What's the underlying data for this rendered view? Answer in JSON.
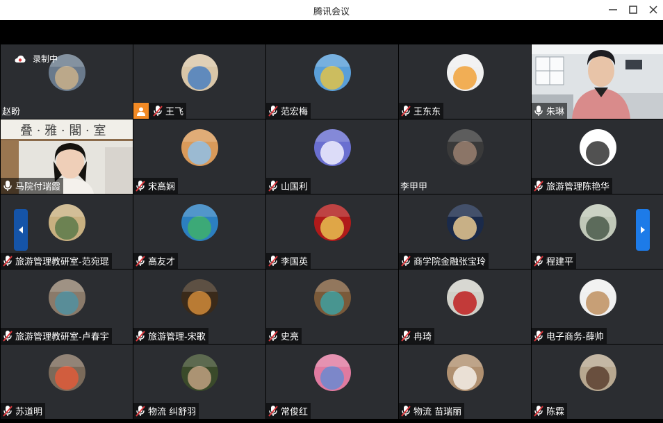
{
  "window": {
    "title": "腾讯会议"
  },
  "recording": {
    "label": "录制中"
  },
  "participants": [
    {
      "name": "赵盼",
      "mic": "none",
      "avatar": "boy-photo-icon"
    },
    {
      "name": "王飞",
      "mic": "muted",
      "host": true,
      "avatar": "castle-photo-icon"
    },
    {
      "name": "范宏梅",
      "mic": "muted",
      "avatar": "wheat-photo-icon"
    },
    {
      "name": "王东东",
      "mic": "muted",
      "avatar": "flower-icon"
    },
    {
      "name": "朱琳",
      "mic": "on",
      "video": true
    },
    {
      "name": "马院付瑞霞",
      "mic": "on",
      "video": true
    },
    {
      "name": "宋高娴",
      "mic": "muted",
      "avatar": "bird-photo-icon"
    },
    {
      "name": "山国利",
      "mic": "muted",
      "avatar": "palace-photo-icon"
    },
    {
      "name": "李甲甲",
      "mic": "none",
      "avatar": "man-photo-icon"
    },
    {
      "name": "旅游管理陈艳华",
      "mic": "muted",
      "avatar": "cartoon-avatar-icon"
    },
    {
      "name": "旅游管理教研室-范宛琨",
      "mic": "muted",
      "avatar": "palm-tree-icon"
    },
    {
      "name": "高友才",
      "mic": "muted",
      "avatar": "beach-photo-icon"
    },
    {
      "name": "李国英",
      "mic": "muted",
      "avatar": "opera-photo-icon"
    },
    {
      "name": "商学院金融张宝玲",
      "mic": "muted",
      "avatar": "pearl-earring-icon"
    },
    {
      "name": "程建平",
      "mic": "muted",
      "avatar": "landscape-photo-icon"
    },
    {
      "name": "旅游管理教研室-卢春宇",
      "mic": "muted",
      "avatar": "street-photo-icon"
    },
    {
      "name": "旅游管理-宋歌",
      "mic": "muted",
      "avatar": "silhouette-icon"
    },
    {
      "name": "史亮",
      "mic": "muted",
      "avatar": "bowl-photo-icon"
    },
    {
      "name": "冉琦",
      "mic": "muted",
      "avatar": "phone-booth-icon"
    },
    {
      "name": "电子商务-薛帅",
      "mic": "muted",
      "avatar": "room-photo-icon"
    },
    {
      "name": "苏道明",
      "mic": "muted",
      "avatar": "food-photo-icon"
    },
    {
      "name": "物流 纠舒羽",
      "mic": "muted",
      "avatar": "woman-photo-icon"
    },
    {
      "name": "常俊红",
      "mic": "muted",
      "avatar": "sunset-photo-icon"
    },
    {
      "name": "物流 苗瑞丽",
      "mic": "muted",
      "avatar": "coffee-cup-icon"
    },
    {
      "name": "陈霖",
      "mic": "muted",
      "avatar": "couple-photo-icon"
    }
  ],
  "colors": {
    "tile_bg": "#2b2d31",
    "host_badge": "#f28a25",
    "muted_red": "#e0393e",
    "active_outline": "#19c65a",
    "nav_arrow": "#1d7be8"
  }
}
